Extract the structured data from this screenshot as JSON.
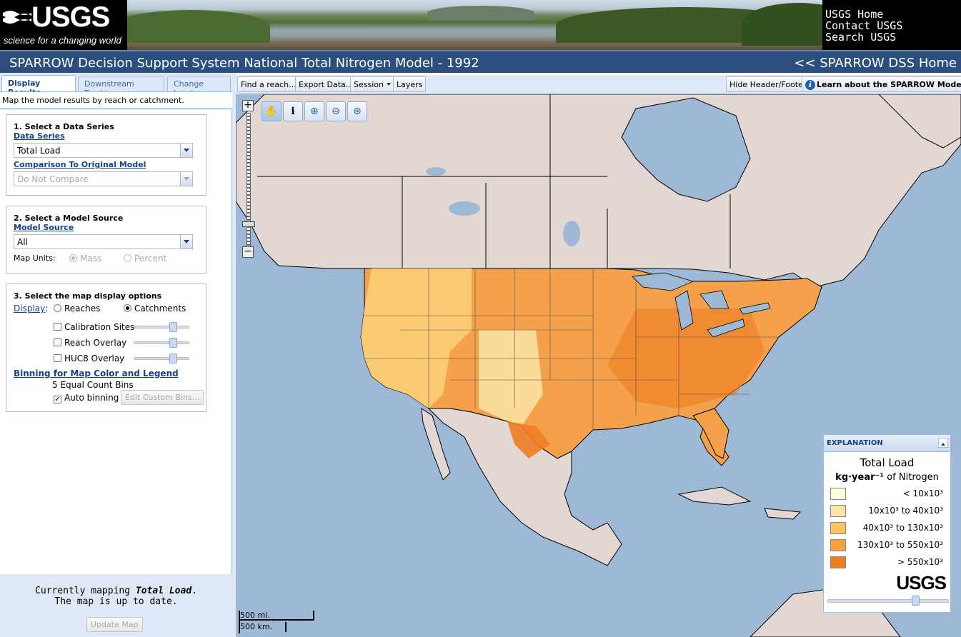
{
  "banner": {
    "logo_text": "USGS",
    "logo_tagline": "science for a changing world",
    "links": [
      "USGS Home",
      "Contact USGS",
      "Search USGS"
    ]
  },
  "titlebar": {
    "title": "SPARROW Decision Support System National Total Nitrogen Model - 1992",
    "home_link": "<< SPARROW DSS Home"
  },
  "left_panel": {
    "tabs": [
      "Display Results",
      "Downstream Tracking",
      "Change Inputs"
    ],
    "active_tab": "Display Results",
    "description": "Map the model results by reach or catchment.",
    "section1": {
      "heading": "1. Select a Data Series",
      "data_series_label": "Data Series",
      "data_series_value": "Total Load",
      "comparison_label": "Comparison To Original Model",
      "comparison_value": "Do Not Compare"
    },
    "section2": {
      "heading": "2. Select a Model Source",
      "model_source_label": "Model Source",
      "model_source_value": "All",
      "map_units_label": "Map Units:",
      "units": [
        "Mass",
        "Percent"
      ],
      "selected_unit": "Mass"
    },
    "section3": {
      "heading": "3. Select the map display options",
      "display_label": "Display",
      "display_options": [
        "Reaches",
        "Catchments"
      ],
      "selected_display": "Catchments",
      "overlays": [
        "Calibration Sites",
        "Reach Overlay",
        "HUC8 Overlay"
      ],
      "binning_label": "Binning for Map Color and Legend",
      "bins_text": "5 Equal Count Bins",
      "auto_binning_label": "Auto binning",
      "auto_binning_checked": true,
      "edit_bins_button": "Edit Custom Bins..."
    },
    "status": {
      "prefix": "Currently mapping ",
      "series": "Total Load",
      "suffix": ".",
      "line2": "The map is up to date.",
      "update_button": "Update Map"
    }
  },
  "map_toolbar": {
    "find_reach": "Find a reach...",
    "export_data": "Export Data...",
    "session": "Session",
    "layers": "Layers",
    "hide_header": "Hide Header/Footer",
    "learn_more": "Learn about the SPARROW Model"
  },
  "map": {
    "tools": [
      "pan-icon",
      "identify-icon",
      "zoom-in-icon",
      "zoom-out-icon",
      "zoom-extent-icon"
    ],
    "scale_mi": "500 mi.",
    "scale_km": "500 km."
  },
  "legend": {
    "header": "EXPLANATION",
    "title": "Total Load",
    "units_bold": "kg·year⁻¹",
    "units_rest": " of Nitrogen",
    "bins": [
      {
        "label": "<   10x10³",
        "color": "#fffdd8"
      },
      {
        "label": "10x10³ to   40x10³",
        "color": "#fde4a4"
      },
      {
        "label": "40x10³ to 130x10³",
        "color": "#fbc463"
      },
      {
        "label": "130x10³ to 550x10³",
        "color": "#f8a03a"
      },
      {
        "label": "> 550x10³",
        "color": "#ee7d22"
      }
    ],
    "logo": "USGS"
  },
  "colors": {
    "title_bar": "#2d4f80",
    "panel_bg": "#dfe8f6",
    "link": "#15428b",
    "ocean": "#9eb9d5",
    "land": "#e2d7d2"
  }
}
